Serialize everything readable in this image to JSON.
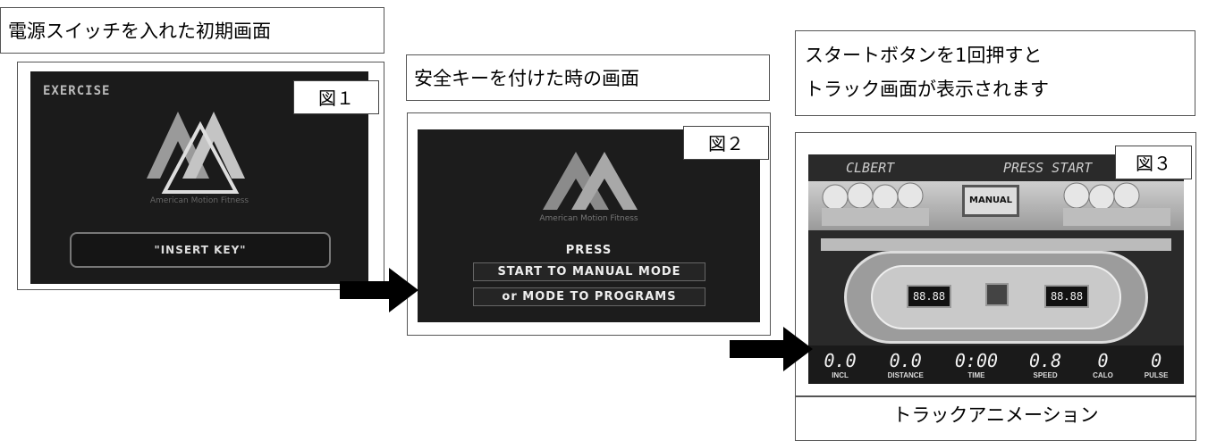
{
  "captions": {
    "power_on": "電源スイッチを入れた初期画面",
    "safety_key": "安全キーを付けた時の画面",
    "start_line1": "スタートボタンを1回押すと",
    "start_line2": "トラック画面が表示されます",
    "track_anim": "トラックアニメーション"
  },
  "figures": {
    "fig1": "図１",
    "fig2": "図２",
    "fig3": "図３"
  },
  "screen1": {
    "corner_text": "EXERCISE",
    "brand": "American Motion Fitness",
    "button": "\"INSERT KEY\""
  },
  "screen2": {
    "brand": "American Motion Fitness",
    "press": "PRESS",
    "btn1": "START TO MANUAL MODE",
    "btn2": "or MODE TO PROGRAMS"
  },
  "screen3": {
    "top_left": "CLBERT",
    "top_right": "PRESS START",
    "mode": "MANUAL",
    "left_display": "88.88",
    "right_display": "88.88",
    "stats": [
      {
        "value": "0.0",
        "label": "INCL"
      },
      {
        "value": "0.0",
        "label": "DISTANCE"
      },
      {
        "value": "0:00",
        "label": "TIME"
      },
      {
        "value": "0.8",
        "label": "SPEED"
      },
      {
        "value": "0",
        "label": "CALO"
      },
      {
        "value": "0",
        "label": "PULSE"
      }
    ]
  },
  "colors": {
    "screen_bg": "#1b1b1b",
    "logo_gray": "#8a8a8a",
    "display_bg": "#111111"
  }
}
